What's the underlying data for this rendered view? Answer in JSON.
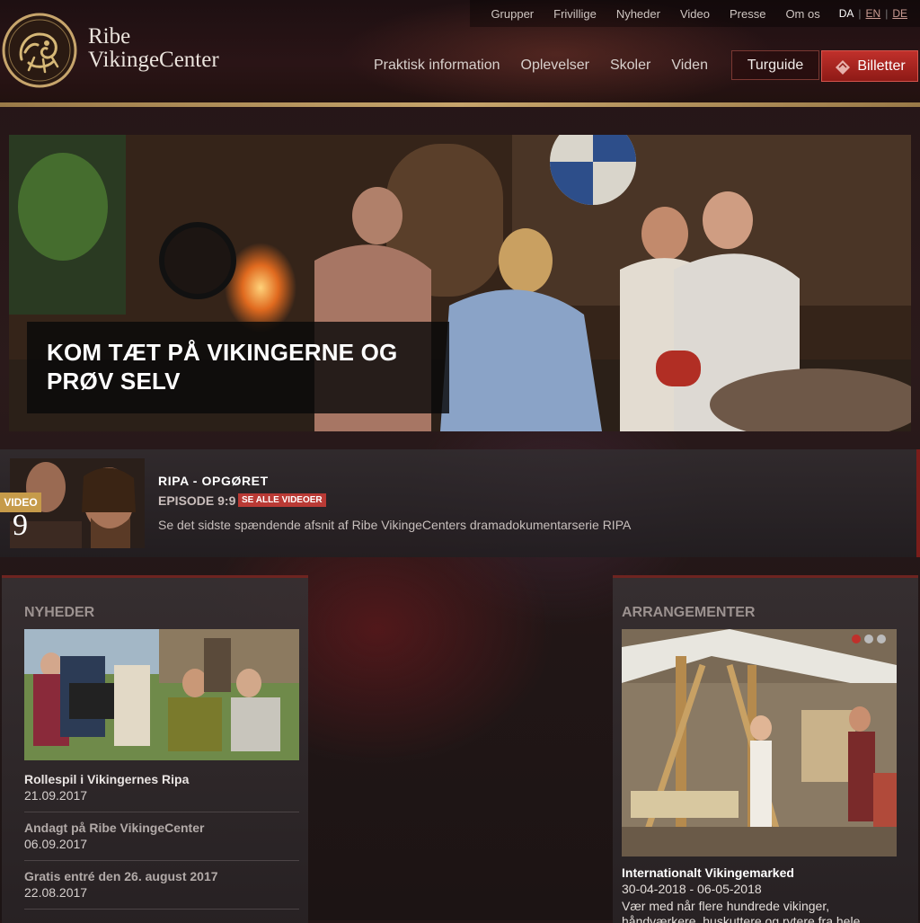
{
  "topnav": {
    "items": [
      "Grupper",
      "Frivillige",
      "Nyheder",
      "Video",
      "Presse",
      "Om os"
    ],
    "languages": [
      "DA",
      "EN",
      "DE"
    ],
    "active_language": "DA"
  },
  "logo": {
    "line1": "Ribe",
    "line2": "VikingeCenter"
  },
  "mainnav": {
    "items": [
      "Praktisk information",
      "Oplevelser",
      "Skoler",
      "Viden"
    ]
  },
  "buttons": {
    "turguide": "Turguide",
    "billetter": "Billetter"
  },
  "hero": {
    "caption": "KOM TÆT PÅ VIKINGERNE OG PRØV SELV"
  },
  "video": {
    "badge": "VIDEO",
    "number": "9",
    "title": "RIPA - OPGØRET",
    "episode": "EPISODE 9:9",
    "see_all": "SE ALLE VIDEOER",
    "description": "Se det sidste spændende afsnit af Ribe VikingeCenters dramadokumentarserie RIPA"
  },
  "news": {
    "heading": "NYHEDER",
    "items": [
      {
        "title": "Rollespil i Vikingernes Ripa",
        "date": "21.09.2017"
      },
      {
        "title": "Andagt på Ribe VikingeCenter",
        "date": "06.09.2017"
      },
      {
        "title": "Gratis entré den 26. august 2017",
        "date": "22.08.2017"
      }
    ]
  },
  "events": {
    "heading": "ARRANGEMENTER",
    "title": "Internationalt Vikingemarked",
    "date": "30-04-2018 - 06-05-2018",
    "description": "Vær med når flere hundrede vikinger, håndværkere, huskuttere og rytere fra hele Europa mødes"
  },
  "colors": {
    "accent": "#c0302b",
    "gold": "#c7a56c"
  }
}
